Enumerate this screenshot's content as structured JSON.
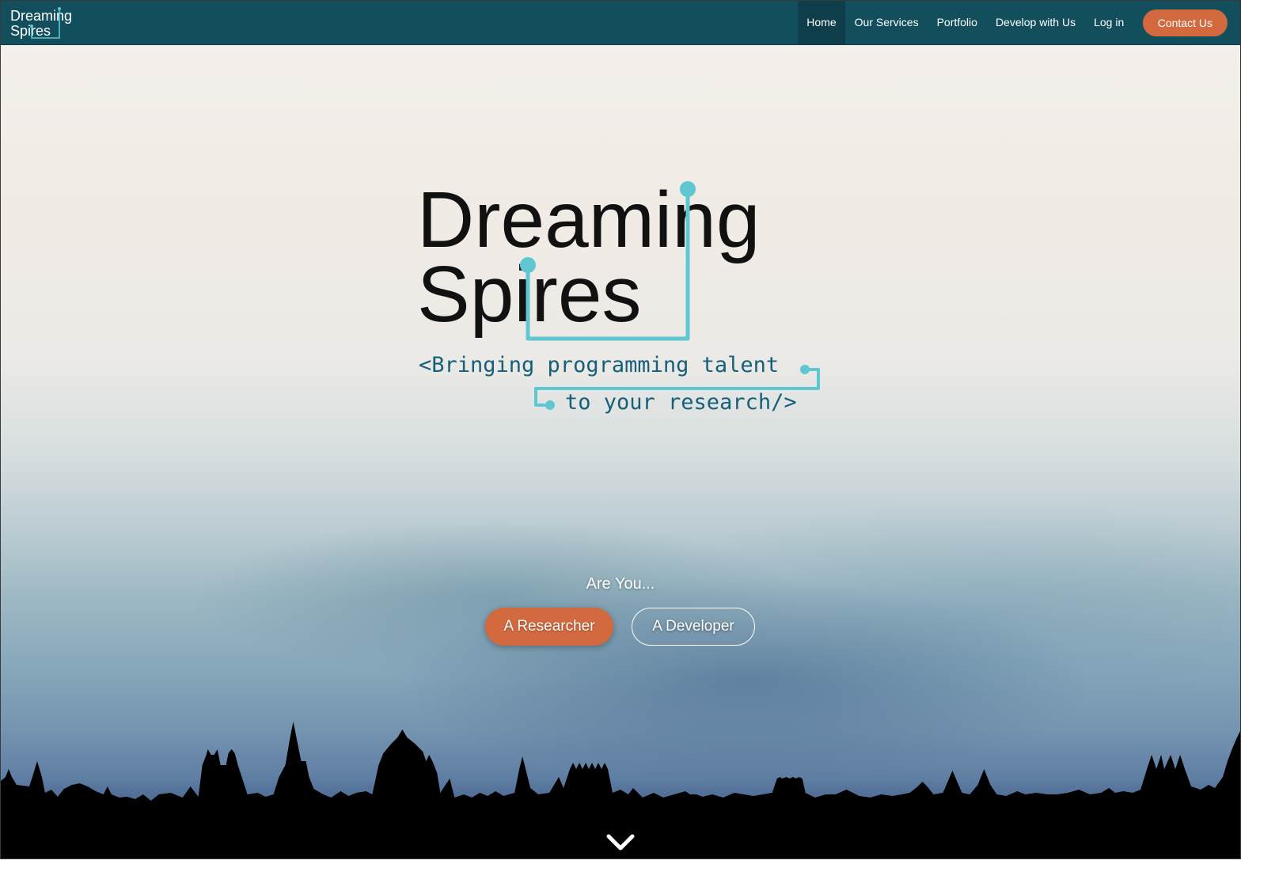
{
  "brand": {
    "line1": "Dreaming",
    "line2": "Spires"
  },
  "nav": {
    "items": [
      {
        "label": "Home",
        "active": true
      },
      {
        "label": "Our Services"
      },
      {
        "label": "Portfolio"
      },
      {
        "label": "Develop with Us"
      },
      {
        "label": "Log in"
      }
    ],
    "contact_label": "Contact Us"
  },
  "hero": {
    "logo_line1": "Dreaming",
    "logo_line2": "Spires",
    "tagline_line1": "<Bringing programming talent",
    "tagline_line2": "to your research/>",
    "are_you": "Are You...",
    "researcher_label": "A Researcher",
    "developer_label": "A Developer"
  },
  "icons": {
    "scroll": "chevron-down-icon"
  },
  "colors": {
    "nav_bg": "#124e5b",
    "accent_orange": "#d2693f",
    "logo_teal": "#5ec7d2",
    "tagline_blue": "#155f7a"
  }
}
